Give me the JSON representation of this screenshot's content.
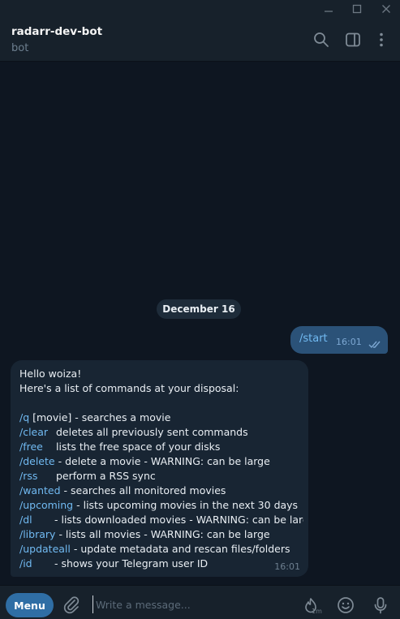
{
  "window": {
    "buttons": [
      "minimize",
      "maximize",
      "close"
    ]
  },
  "header": {
    "name": "radarr-dev-bot",
    "status": "bot",
    "icons": [
      "search-icon",
      "sidebar-toggle-icon",
      "more-vert-icon"
    ]
  },
  "chat": {
    "date": "December 16",
    "outgoing": {
      "text": "/start",
      "time": "16:01",
      "status": "read"
    },
    "incoming": {
      "greeting": "Hello woiza!",
      "intro": "Here's a list of commands at your disposal:",
      "commands": [
        {
          "cmd": "/q",
          "desc": " [movie] - searches a movie"
        },
        {
          "cmd": "/clear",
          "desc": "deletes all previously sent commands"
        },
        {
          "cmd": "/free",
          "desc": "lists the free space of your disks"
        },
        {
          "cmd": "/delete",
          "desc": "- delete a movie - WARNING: can be large"
        },
        {
          "cmd": "/rss",
          "desc": "perform a RSS sync"
        },
        {
          "cmd": "/wanted",
          "desc": "- searches all monitored movies"
        },
        {
          "cmd": "/upcoming",
          "desc": "- lists upcoming movies in the next 30 days"
        },
        {
          "cmd": "/dl",
          "desc": "- lists downloaded movies - WARNING: can be large"
        },
        {
          "cmd": "/library",
          "desc": "- lists all movies - WARNING: can be large"
        },
        {
          "cmd": "/updateall",
          "desc": "- update metadata and rescan files/folders"
        },
        {
          "cmd": "/id",
          "desc": "- shows your Telegram user ID"
        }
      ],
      "time": "16:01"
    }
  },
  "composer": {
    "menu_label": "Menu",
    "placeholder": "Write a message...",
    "slow_mode_label": "1m"
  },
  "colors": {
    "background": "#0e1621",
    "panel": "#17212b",
    "incoming_bubble": "#182533",
    "outgoing_bubble": "#2b5278",
    "link": "#71baf2",
    "menu_button": "#2f6ea5"
  }
}
